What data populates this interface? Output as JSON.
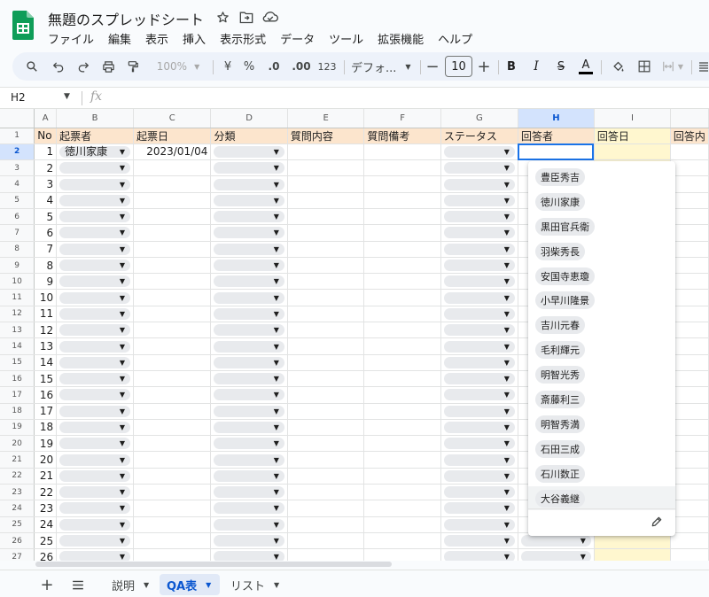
{
  "header": {
    "title": "無題のスプレッドシート",
    "icons": [
      "star-icon",
      "move-to-folder-icon",
      "cloud-saved-icon"
    ]
  },
  "menu": [
    "ファイル",
    "編集",
    "表示",
    "挿入",
    "表示形式",
    "データ",
    "ツール",
    "拡張機能",
    "ヘルプ"
  ],
  "toolbar": {
    "zoom": "100%",
    "currency": "¥",
    "percent": "%",
    "decrease_decimal": ".0",
    "increase_decimal": ".00",
    "number_format": "123",
    "font": "デフォ...",
    "font_size": "10",
    "bold": "B",
    "italic": "I",
    "strikethrough": "S",
    "text_color": "A"
  },
  "formula_bar": {
    "name_box": "H2",
    "fx": "fx",
    "value": ""
  },
  "grid": {
    "column_headers": [
      "A",
      "B",
      "C",
      "D",
      "E",
      "F",
      "G",
      "H",
      "I",
      ""
    ],
    "selected_column": "H",
    "selected_row": "2",
    "row_numbers": [
      "1",
      "2",
      "3",
      "4",
      "5",
      "6",
      "7",
      "8",
      "9",
      "10",
      "11",
      "12",
      "13",
      "14",
      "15",
      "16",
      "17",
      "18",
      "19",
      "20",
      "21",
      "22",
      "23",
      "24",
      "25",
      "26",
      "27"
    ],
    "header_row": [
      "No",
      "起票者",
      "起票日",
      "分類",
      "質問内容",
      "質問備考",
      "ステータス",
      "回答者",
      "回答日",
      "回答内"
    ],
    "data_rows": [
      {
        "no": "1",
        "requester": "徳川家康",
        "date": "2023/01/04"
      },
      {
        "no": "2"
      },
      {
        "no": "3"
      },
      {
        "no": "4"
      },
      {
        "no": "5"
      },
      {
        "no": "6"
      },
      {
        "no": "7"
      },
      {
        "no": "8"
      },
      {
        "no": "9"
      },
      {
        "no": "10"
      },
      {
        "no": "11"
      },
      {
        "no": "12"
      },
      {
        "no": "13"
      },
      {
        "no": "14"
      },
      {
        "no": "15"
      },
      {
        "no": "16"
      },
      {
        "no": "17"
      },
      {
        "no": "18"
      },
      {
        "no": "19"
      },
      {
        "no": "20"
      },
      {
        "no": "21"
      },
      {
        "no": "22"
      },
      {
        "no": "23"
      },
      {
        "no": "24"
      },
      {
        "no": "25"
      },
      {
        "no": "26"
      }
    ]
  },
  "dropdown": {
    "options": [
      "豊臣秀吉",
      "徳川家康",
      "黒田官兵衛",
      "羽柴秀長",
      "安国寺恵瓊",
      "小早川隆景",
      "吉川元春",
      "毛利輝元",
      "明智光秀",
      "斎藤利三",
      "明智秀満",
      "石田三成",
      "石川数正",
      "大谷義継"
    ],
    "hovered_index": 13
  },
  "sheet_tabs": [
    {
      "label": "説明",
      "active": false
    },
    {
      "label": "QA表",
      "active": true
    },
    {
      "label": "リスト",
      "active": false
    }
  ],
  "colors": {
    "header_fill": "#fce5cd",
    "selection": "#1a73e8",
    "chip": "#e8eaed",
    "accent": "#0b57d0"
  }
}
